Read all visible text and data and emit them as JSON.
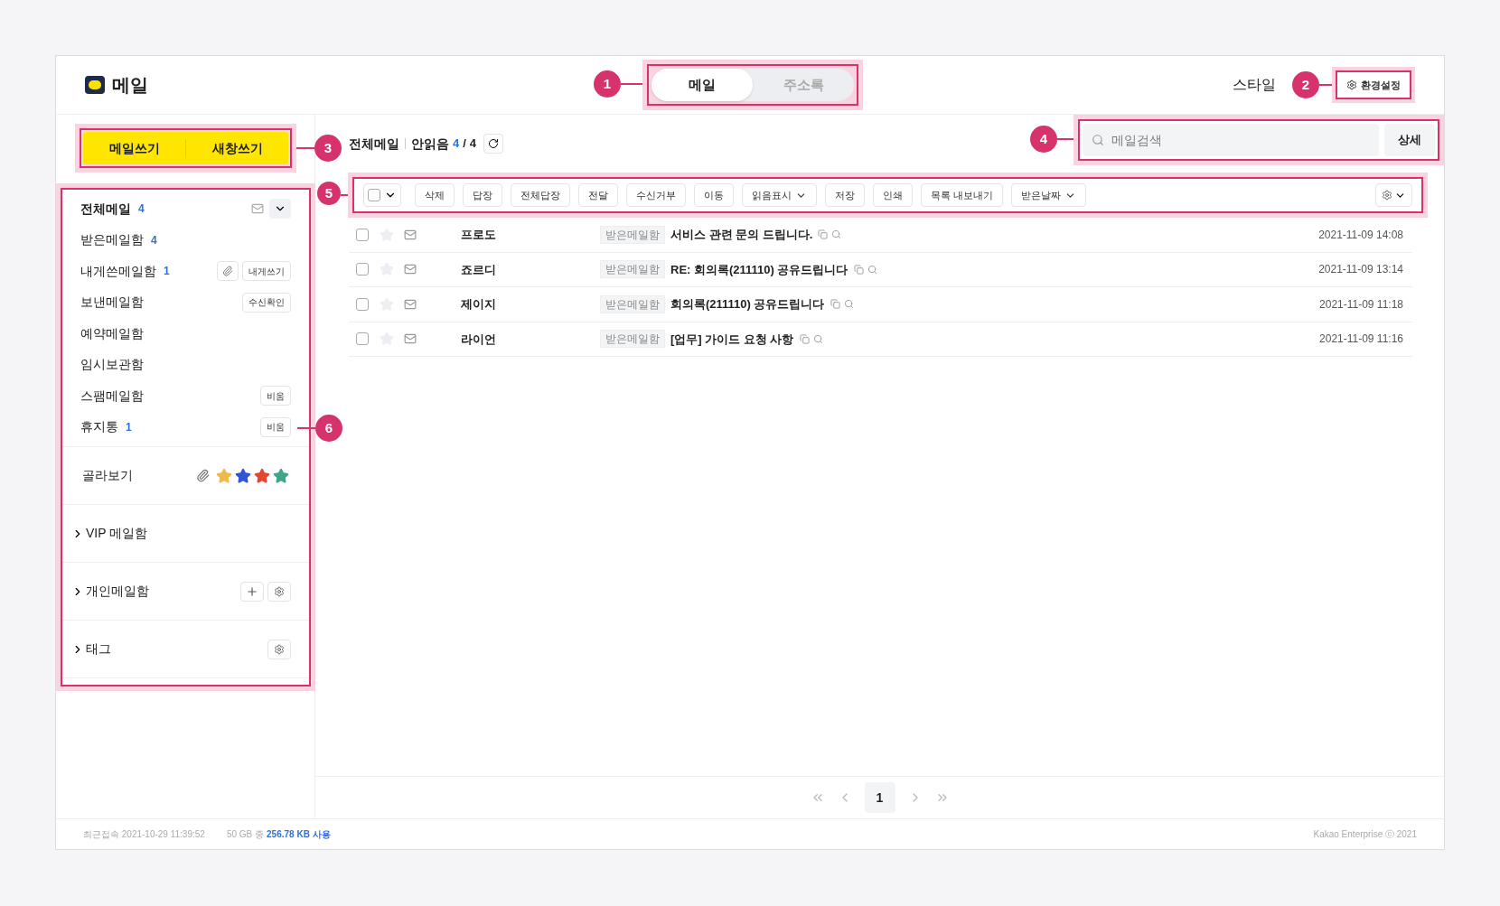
{
  "app": {
    "title": "메일"
  },
  "tabs": [
    {
      "label": "메일",
      "selected": true
    },
    {
      "label": "주소록",
      "selected": false
    }
  ],
  "user": {
    "name": "스타일",
    "settings": "환경설정"
  },
  "compose": [
    "메일쓰기",
    "새창쓰기"
  ],
  "folders": [
    {
      "label": "전체메일",
      "count": "4",
      "bold": true,
      "actions": [
        {
          "kind": "envelope"
        },
        {
          "kind": "caret"
        }
      ]
    },
    {
      "label": "받은메일함",
      "count": "4",
      "bold": false
    },
    {
      "label": "내게쓴메일함",
      "count": "1",
      "bold": false,
      "actions": [
        {
          "kind": "clip"
        },
        {
          "kind": "text",
          "label": "내게쓰기"
        }
      ]
    },
    {
      "label": "보낸메일함",
      "bold": false,
      "actions": [
        {
          "kind": "text",
          "label": "수신확인"
        }
      ]
    },
    {
      "label": "예약메일함",
      "bold": false
    },
    {
      "label": "임시보관함",
      "bold": false
    },
    {
      "label": "스팸메일함",
      "bold": false,
      "actions": [
        {
          "kind": "text",
          "label": "비움"
        }
      ]
    },
    {
      "label": "휴지통",
      "count": "1",
      "bold": false,
      "actions": [
        {
          "kind": "text",
          "label": "비움"
        }
      ]
    }
  ],
  "filter": {
    "label": "골라보기",
    "stars": [
      {
        "color": "#f0b94a"
      },
      {
        "color": "#2f54d9"
      },
      {
        "color": "#e6452f"
      },
      {
        "color": "#3ea58a"
      }
    ]
  },
  "sections": [
    {
      "label": "VIP 메일함",
      "expanded": false
    },
    {
      "label": "개인메일함",
      "expanded": false,
      "actions": [
        {
          "kind": "plus"
        },
        {
          "kind": "gear"
        }
      ]
    },
    {
      "label": "태그",
      "expanded": false,
      "actions": [
        {
          "kind": "gear"
        }
      ]
    }
  ],
  "list_header": {
    "folder": "전체메일",
    "unread_label": "안읽음",
    "unread": "4",
    "separator": "/",
    "total": "4"
  },
  "search": {
    "placeholder": "메일검색",
    "detail": "상세"
  },
  "select_all": {
    "checked": false
  },
  "toolbar": [
    {
      "label": "삭제",
      "kind": "button"
    },
    {
      "label": "답장",
      "kind": "button"
    },
    {
      "label": "전체답장",
      "kind": "button"
    },
    {
      "label": "전달",
      "kind": "button"
    },
    {
      "label": "수신거부",
      "kind": "button"
    },
    {
      "label": "이동",
      "kind": "button"
    },
    {
      "label": "읽음표시",
      "kind": "dropdown"
    },
    {
      "label": "저장",
      "kind": "button"
    },
    {
      "label": "인쇄",
      "kind": "button"
    },
    {
      "label": "목록 내보내기",
      "kind": "button"
    },
    {
      "label": "받은날짜",
      "kind": "dropdown"
    }
  ],
  "messages": [
    {
      "checked": false,
      "starred": false,
      "sender": "프로도",
      "folder": "받은메일함",
      "subject": "서비스 관련 문의 드립니다.",
      "date": "2021-11-09 14:08"
    },
    {
      "checked": false,
      "starred": false,
      "sender": "죠르디",
      "folder": "받은메일함",
      "subject": "RE: 회의록(211110) 공유드립니다",
      "date": "2021-11-09 13:14"
    },
    {
      "checked": false,
      "starred": false,
      "sender": "제이지",
      "folder": "받은메일함",
      "subject": "회의록(211110) 공유드립니다",
      "date": "2021-11-09 11:18"
    },
    {
      "checked": false,
      "starred": false,
      "sender": "라이언",
      "folder": "받은메일함",
      "subject": "[업무] 가이드 요청 사항",
      "date": "2021-11-09 11:16"
    }
  ],
  "pagination": {
    "pages": [
      {
        "label": "1",
        "selected": true
      }
    ]
  },
  "footer": {
    "last_login": "최근접속 2021-10-29 11:39:52",
    "quota": "50 GB 중",
    "used": "256.78 KB 사용",
    "copyright": "Kakao Enterprise ⓒ 2021"
  },
  "annotations": [
    "1",
    "2",
    "3",
    "4",
    "5",
    "6"
  ]
}
